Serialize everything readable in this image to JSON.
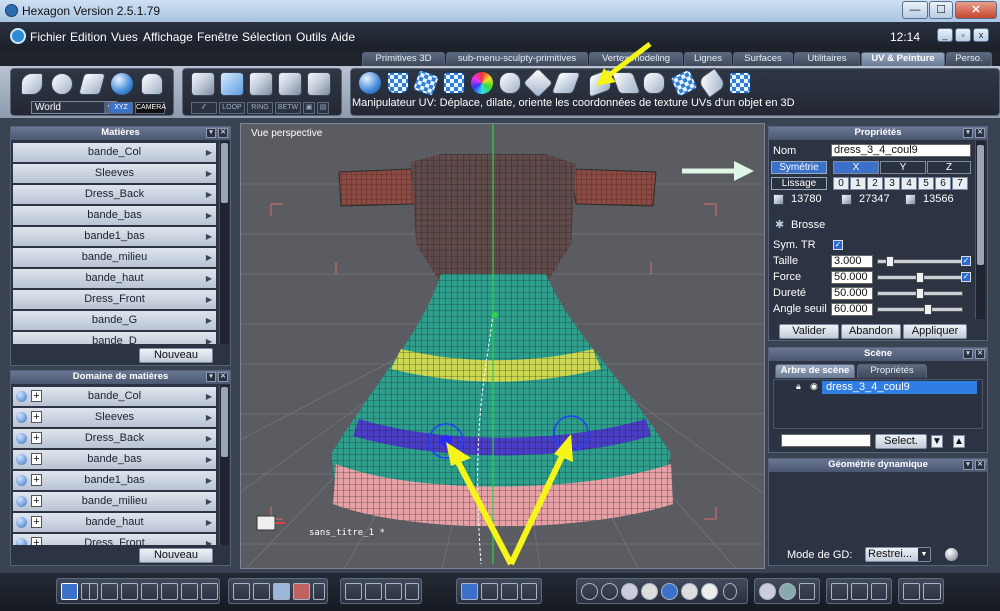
{
  "window": {
    "title": "Hexagon Version 2.5.1.79",
    "controls": [
      "minimize",
      "maximize",
      "close"
    ]
  },
  "menubar": {
    "items": [
      "Fichier",
      "Edition",
      "Vues",
      "Affichage",
      "Fenêtre",
      "Sélection",
      "Outils",
      "Aide"
    ],
    "clock": "12:14"
  },
  "tabs": [
    {
      "label": "Primitives 3D",
      "active": false
    },
    {
      "label": "sub-menu-sculpty-primitives",
      "active": false
    },
    {
      "label": "Vertex modeling",
      "active": false
    },
    {
      "label": "Lignes",
      "active": false
    },
    {
      "label": "Surfaces",
      "active": false
    },
    {
      "label": "Utilitaires",
      "active": false
    },
    {
      "label": "UV & Peinture",
      "active": true
    },
    {
      "label": "Perso.",
      "active": false
    }
  ],
  "toolbar": {
    "coord_select": "World",
    "coord_buttons": [
      "XYZ",
      "CAMERA"
    ],
    "sel_buttons": [
      "LOOP",
      "RING",
      "BETW"
    ],
    "hint": "Manipulateur UV: Déplace, dilate, oriente les coordonnées de texture UVs d'un objet en 3D"
  },
  "materials_panel": {
    "title": "Matières",
    "items": [
      "bande_Col",
      "Sleeves",
      "Dress_Back",
      "bande_bas",
      "bande1_bas",
      "bande_milieu",
      "bande_haut",
      "Dress_Front",
      "bande_G",
      "bande_D"
    ],
    "new_button": "Nouveau"
  },
  "domains_panel": {
    "title": "Domaine de matières",
    "items": [
      "bande_Col",
      "Sleeves",
      "Dress_Back",
      "bande_bas",
      "bande1_bas",
      "bande_milieu",
      "bande_haut",
      "Dress_Front"
    ],
    "new_button": "Nouveau"
  },
  "viewport": {
    "label": "Vue perspective",
    "file": "sans_titre_1 *"
  },
  "properties": {
    "title": "Propriétés",
    "name_label": "Nom",
    "name_value": "dress_3_4_coul9",
    "symmetry_label": "Symétrie",
    "axes": [
      "X",
      "Y",
      "Z"
    ],
    "smoothing_label": "Lissage",
    "smoothing_levels": [
      "0",
      "1",
      "2",
      "3",
      "4",
      "5",
      "6",
      "7"
    ],
    "counts": [
      "13780",
      "27347",
      "13566"
    ],
    "brush_label": "Brosse",
    "sym_tr_label": "Sym. TR",
    "params": [
      {
        "label": "Taille",
        "value": "3.000",
        "level": 0.1
      },
      {
        "label": "Force",
        "value": "50.000",
        "level": 0.45
      },
      {
        "label": "Dureté",
        "value": "50.000",
        "level": 0.45
      },
      {
        "label": "Angle seuil",
        "value": "60.000",
        "level": 0.55
      }
    ],
    "buttons": [
      "Valider",
      "Abandon",
      "Appliquer"
    ]
  },
  "scene": {
    "title": "Scène",
    "tabs": [
      "Arbre de scène",
      "Propriétés"
    ],
    "object": "dress_3_4_coul9",
    "select_button": "Select."
  },
  "dyn_geo": {
    "title": "Géométrie dynamique",
    "mode_label": "Mode de GD:",
    "mode_value": "Restrei..."
  },
  "colors": {
    "accent": "#3b71c8",
    "annotation_arrow": "#f5f51a",
    "panel_bg": "#2c3342"
  }
}
